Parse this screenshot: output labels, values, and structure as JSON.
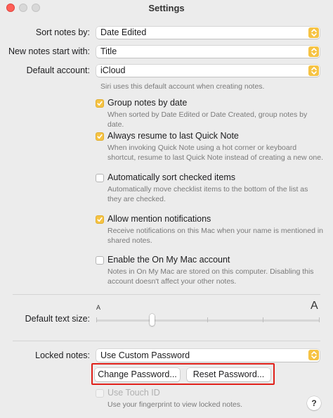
{
  "window": {
    "title": "Settings"
  },
  "colors": {
    "accent": "#f6c343",
    "highlight": "#e0201a"
  },
  "sort_notes": {
    "label": "Sort notes by:",
    "value": "Date Edited"
  },
  "new_notes": {
    "label": "New notes start with:",
    "value": "Title"
  },
  "default_account": {
    "label": "Default account:",
    "value": "iCloud",
    "hint": "Siri uses this default account when creating notes."
  },
  "options": [
    {
      "label": "Group notes by date",
      "checked": true,
      "desc": [
        "When sorted by Date Edited or Date Created, group notes by date."
      ]
    },
    {
      "label": "Always resume to last Quick Note",
      "checked": true,
      "desc": [
        "When invoking Quick Note using a hot corner or keyboard",
        "shortcut, resume to last Quick Note instead of creating a new one."
      ]
    },
    {
      "label": "Automatically sort checked items",
      "checked": false,
      "desc": [
        "Automatically move checklist items to the bottom of the list as",
        "they are checked."
      ]
    },
    {
      "label": "Allow mention notifications",
      "checked": true,
      "desc": [
        "Receive notifications on this Mac when your name is mentioned in",
        "shared notes."
      ]
    },
    {
      "label": "Enable the On My Mac account",
      "checked": false,
      "desc": [
        "Notes in On My Mac are stored on this computer. Disabling this",
        "account doesn't affect your other notes."
      ]
    }
  ],
  "text_size": {
    "label": "Default text size:",
    "small_glyph": "A",
    "large_glyph": "A",
    "level": 0.25
  },
  "locked_notes": {
    "label": "Locked notes:",
    "value": "Use Custom Password",
    "change_password": "Change Password...",
    "reset_password": "Reset Password...",
    "touch_id_label": "Use Touch ID",
    "touch_id_desc": "Use your fingerprint to view locked notes."
  },
  "help": {
    "glyph": "?"
  },
  "icons": {
    "stepper": "chevron-up-down-icon",
    "check": "checkmark-icon"
  }
}
